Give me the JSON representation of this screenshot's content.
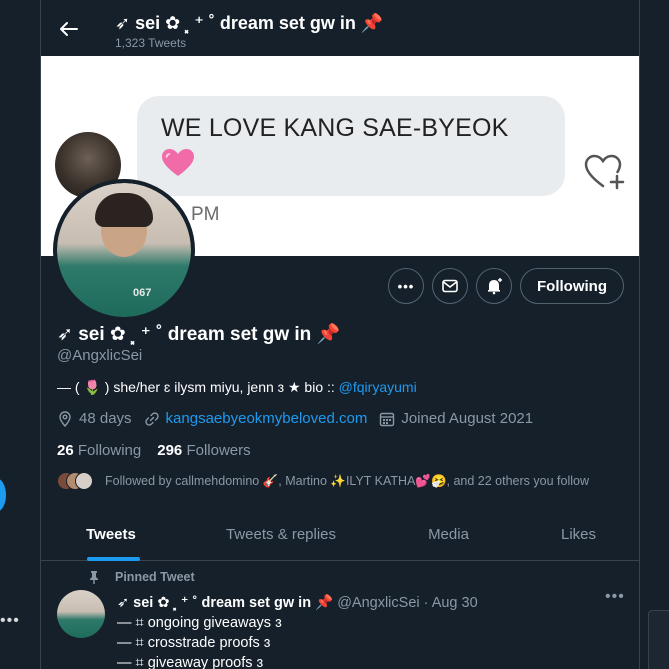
{
  "header": {
    "back_icon": "arrow-left-icon",
    "title": "➶ sei ✿ ⸼ ⁺ ˚ dream set gw in 📌",
    "tweet_count": "1,323 Tweets"
  },
  "banner": {
    "bubble_text": "WE LOVE KANG SAE-BYEOK",
    "bubble_emoji": "💗",
    "time_fragment": "PM",
    "heart_icon": "heart-plus-icon"
  },
  "avatar": {
    "jersey_number": "067"
  },
  "actions": {
    "more_icon": "more-icon",
    "message_icon": "mail-icon",
    "notify_icon": "bell-plus-icon",
    "follow_label": "Following"
  },
  "profile": {
    "name": "➶ sei ✿ ⸼ ⁺ ˚ dream set gw in 📌",
    "handle": "@AngxlicSei",
    "bio_text": "— ( 🌷 ) she/her ɛ ilysm miyu, jenn ɜ ★ bio :: ",
    "bio_link": "@fqiryayumi",
    "location": "48 days",
    "website": "kangsaebyeokmybeloved.com",
    "joined": "Joined August 2021",
    "following_count": "26",
    "following_label": "Following",
    "followers_count": "296",
    "followers_label": "Followers",
    "followed_by": "Followed by callmehdomino 🎸, Martino ✨ILYT KATHA💕🤧, and 22 others you follow"
  },
  "tabs": [
    {
      "label": "Tweets",
      "active": true
    },
    {
      "label": "Tweets & replies",
      "active": false
    },
    {
      "label": "Media",
      "active": false
    },
    {
      "label": "Likes",
      "active": false
    }
  ],
  "pinned_tweet": {
    "pinned_label": "Pinned Tweet",
    "author_name": "➶ sei ✿ ⸼ ⁺ ˚ dream set gw in 📌",
    "author_meta": "@AngxlicSei · Aug 30",
    "lines": [
      "— ⌗ ongoing giveaways ɜ",
      "— ⌗ crosstrade proofs ɜ",
      "— ⌗ giveaway proofs ɜ"
    ]
  },
  "colors": {
    "background": "#15202b",
    "accent": "#1d9bf0",
    "muted": "#8b98a5",
    "border": "#38444d"
  }
}
